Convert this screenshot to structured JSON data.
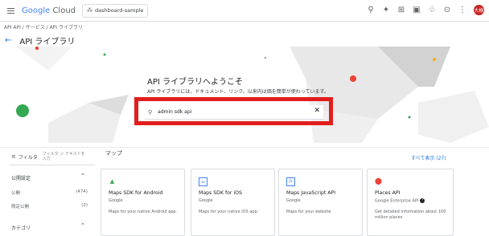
{
  "header": {
    "brand_google": "Google",
    "brand_cloud": " Cloud",
    "project_name": "dashboard-sample",
    "avatar_initials": "大樹"
  },
  "breadcrumb": "API API / サービス / API ライブラリ",
  "page": {
    "title": "API ライブラリ"
  },
  "hero": {
    "title": "API ライブラリへようこそ",
    "subtitle": "API ライブラリには、ドキュメント、リンク、以来内は価を簡単が使わっています。"
  },
  "search": {
    "value": "admin sdk api"
  },
  "filter": {
    "label": "フィルタ",
    "placeholder": "フィルタ ン テキストを 入力"
  },
  "section_title": "マップ",
  "show_all": "すべて表示 (27)",
  "facets": {
    "visibility": {
      "title": "公開設定",
      "items": [
        {
          "label": "公開",
          "count": "(474)"
        },
        {
          "label": "限定公開",
          "count": "(2)"
        }
      ]
    },
    "category": {
      "title": "カテゴリ"
    }
  },
  "cards": [
    {
      "name": "Maps SDK for Android",
      "vendor": "Google",
      "description": "Maps for your native Android app.",
      "icon": "android-icon",
      "icon_color": "#34a853",
      "icon_glyph": "▲"
    },
    {
      "name": "Maps SDK for iOS",
      "vendor": "Google",
      "description": "Maps for your native iOS app.",
      "icon": "ios-icon",
      "icon_color": "#4285f4",
      "icon_glyph": "ios"
    },
    {
      "name": "Maps JavaScript API",
      "vendor": "Google",
      "description": "Maps for your website",
      "icon": "javascript-icon",
      "icon_color": "#4285f4",
      "icon_glyph": "JS"
    },
    {
      "name": "Places API",
      "vendor": "Google Enterprise API",
      "description": "Get detailed information about 100 million places",
      "icon": "map-pin-icon",
      "icon_color": "#ea4335",
      "icon_glyph": "📍"
    }
  ],
  "colors": {
    "accent": "#1a73e8",
    "highlight": "#e11d1d"
  }
}
